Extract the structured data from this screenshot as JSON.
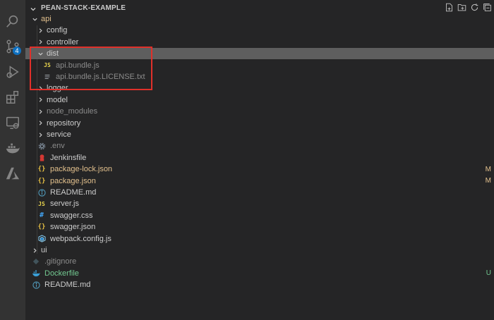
{
  "explorer": {
    "title": "PEAN-STACK-EXAMPLE",
    "header_actions": [
      "new-file-icon",
      "new-folder-icon",
      "refresh-icon",
      "collapse-all-icon"
    ]
  },
  "activity_bar": {
    "items": [
      "search-icon",
      "source-control-icon",
      "run-debug-icon",
      "extensions-icon",
      "remote-explorer-icon",
      "docker-icon",
      "azure-icon"
    ],
    "scm_badge": "4"
  },
  "tree": [
    {
      "label": "api",
      "type": "folder-open",
      "status": ""
    },
    {
      "label": "config",
      "type": "folder",
      "status": ""
    },
    {
      "label": "controller",
      "type": "folder",
      "status": ""
    },
    {
      "label": "dist",
      "type": "folder-open",
      "status": ""
    },
    {
      "label": "api.bundle.js",
      "type": "js",
      "status": ""
    },
    {
      "label": "api.bundle.js.LICENSE.txt",
      "type": "txt",
      "status": ""
    },
    {
      "label": "logger",
      "type": "folder",
      "status": ""
    },
    {
      "label": "model",
      "type": "folder",
      "status": ""
    },
    {
      "label": "node_modules",
      "type": "folder",
      "status": ""
    },
    {
      "label": "repository",
      "type": "folder",
      "status": ""
    },
    {
      "label": "service",
      "type": "folder",
      "status": ""
    },
    {
      "label": ".env",
      "type": "env",
      "status": ""
    },
    {
      "label": "Jenkinsfile",
      "type": "jenkins",
      "status": ""
    },
    {
      "label": "package-lock.json",
      "type": "json",
      "status": "M"
    },
    {
      "label": "package.json",
      "type": "json",
      "status": "M"
    },
    {
      "label": "README.md",
      "type": "info",
      "status": ""
    },
    {
      "label": "server.js",
      "type": "js",
      "status": ""
    },
    {
      "label": "swagger.css",
      "type": "css",
      "status": ""
    },
    {
      "label": "swagger.json",
      "type": "json",
      "status": ""
    },
    {
      "label": "webpack.config.js",
      "type": "webpack",
      "status": ""
    },
    {
      "label": "ui",
      "type": "folder",
      "status": ""
    },
    {
      "label": ".gitignore",
      "type": "git",
      "status": ""
    },
    {
      "label": "Dockerfile",
      "type": "docker",
      "status": "U"
    },
    {
      "label": "README.md",
      "type": "info",
      "status": ""
    }
  ],
  "colors": {
    "sidebar_bg": "#252526",
    "activity_bg": "#333333",
    "selected_row": "#5e5e5e",
    "modified": "#e2c08d",
    "untracked": "#73c991",
    "annotation_box": "#e0302a"
  }
}
